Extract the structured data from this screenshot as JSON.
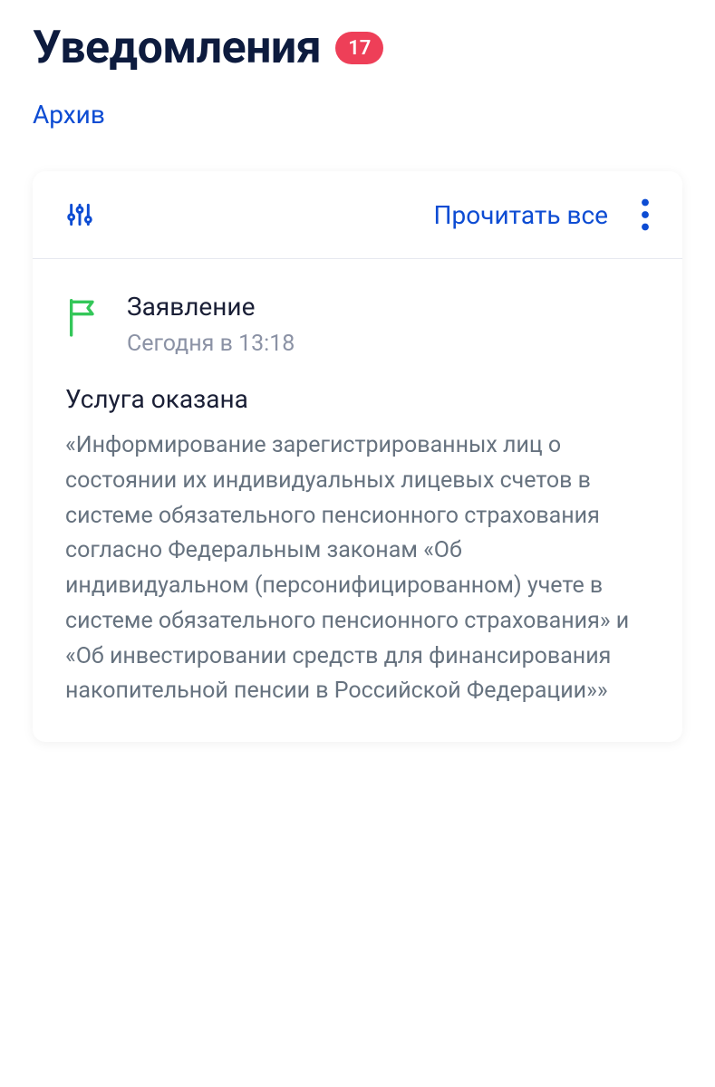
{
  "header": {
    "title": "Уведомления",
    "badge_count": "17",
    "archive_label": "Архив"
  },
  "toolbar": {
    "read_all_label": "Прочитать все"
  },
  "notification": {
    "type": "Заявление",
    "time": "Сегодня в 13:18",
    "status": "Услуга оказана",
    "body": "«Информирование зарегистрированных лиц о состоянии их индивидуальных лицевых счетов в системе обязательного пенсионного страхования согласно Федеральным законам «Об индивидуальном (персонифицированном) учете в системе обязательного пенсионного страхования» и «Об инвестировании средств для финансирования накопительной пенсии в Российской Федерации»»"
  }
}
